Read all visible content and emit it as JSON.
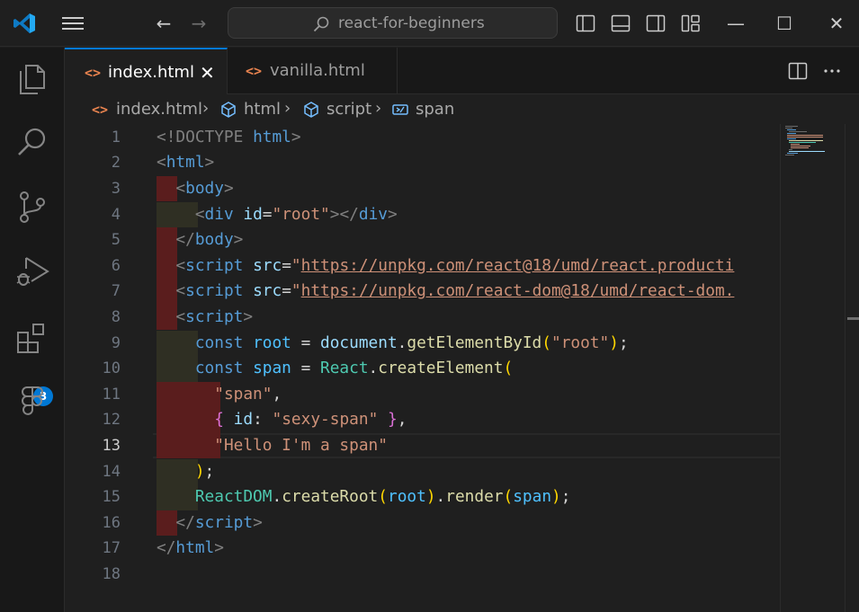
{
  "titlebar": {
    "search_text": "react-for-beginners",
    "back_label": "←",
    "forward_label": "→",
    "minimize_label": "—",
    "maximize_label": "☐",
    "close_label": "✕"
  },
  "activity_bar": {
    "items": [
      "explorer-icon",
      "search-icon",
      "source-control-icon",
      "run-debug-icon",
      "extensions-icon",
      "figma-icon"
    ],
    "extensions_badge": "3"
  },
  "tabs": [
    {
      "label": "index.html",
      "icon": "<>",
      "active": true,
      "close": "✕"
    },
    {
      "label": "vanilla.html",
      "icon": "<>",
      "active": false
    }
  ],
  "breadcrumb": {
    "file": "index.html",
    "items": [
      "html",
      "script",
      "span"
    ],
    "file_icon": "<>"
  },
  "editor": {
    "current_line": 13,
    "line_numbers": [
      "1",
      "2",
      "3",
      "4",
      "5",
      "6",
      "7",
      "8",
      "9",
      "10",
      "11",
      "12",
      "13",
      "14",
      "15",
      "16",
      "17",
      "18"
    ],
    "lines": [
      {
        "tokens": [
          [
            "t-tag",
            "<!DOCTYPE "
          ],
          [
            "t-tname",
            "html"
          ],
          [
            "t-tag",
            ">"
          ]
        ]
      },
      {
        "tokens": [
          [
            "t-tag",
            "<"
          ],
          [
            "t-tname",
            "html"
          ],
          [
            "t-tag",
            ">"
          ]
        ]
      },
      {
        "tokens": [
          [
            "t-plain",
            "  "
          ],
          [
            "t-tag",
            "<"
          ],
          [
            "t-tname",
            "body"
          ],
          [
            "t-tag",
            ">"
          ]
        ]
      },
      {
        "tokens": [
          [
            "t-plain",
            "    "
          ],
          [
            "t-tag",
            "<"
          ],
          [
            "t-tname",
            "div "
          ],
          [
            "t-attr",
            "id"
          ],
          [
            "t-plain",
            "="
          ],
          [
            "t-str",
            "\"root\""
          ],
          [
            "t-tag",
            "></"
          ],
          [
            "t-tname",
            "div"
          ],
          [
            "t-tag",
            ">"
          ]
        ]
      },
      {
        "tokens": [
          [
            "t-plain",
            "  "
          ],
          [
            "t-tag",
            "</"
          ],
          [
            "t-tname",
            "body"
          ],
          [
            "t-tag",
            ">"
          ]
        ]
      },
      {
        "tokens": [
          [
            "t-plain",
            "  "
          ],
          [
            "t-tag",
            "<"
          ],
          [
            "t-tname",
            "script "
          ],
          [
            "t-attr",
            "src"
          ],
          [
            "t-plain",
            "="
          ],
          [
            "t-str",
            "\""
          ],
          [
            "t-link",
            "https://unpkg.com/react@18/umd/react.producti"
          ]
        ]
      },
      {
        "tokens": [
          [
            "t-plain",
            "  "
          ],
          [
            "t-tag",
            "<"
          ],
          [
            "t-tname",
            "script "
          ],
          [
            "t-attr",
            "src"
          ],
          [
            "t-plain",
            "="
          ],
          [
            "t-str",
            "\""
          ],
          [
            "t-link",
            "https://unpkg.com/react-dom@18/umd/react-dom."
          ]
        ]
      },
      {
        "tokens": [
          [
            "t-plain",
            "  "
          ],
          [
            "t-tag",
            "<"
          ],
          [
            "t-tname",
            "script"
          ],
          [
            "t-tag",
            ">"
          ]
        ]
      },
      {
        "tokens": [
          [
            "t-plain",
            "    "
          ],
          [
            "t-kw",
            "const "
          ],
          [
            "t-var",
            "root"
          ],
          [
            "t-plain",
            " = "
          ],
          [
            "t-prop",
            "document"
          ],
          [
            "t-plain",
            "."
          ],
          [
            "t-fn",
            "getElementById"
          ],
          [
            "t-par1",
            "("
          ],
          [
            "t-str",
            "\"root\""
          ],
          [
            "t-par1",
            ")"
          ],
          [
            "t-plain",
            ";"
          ]
        ]
      },
      {
        "tokens": [
          [
            "t-plain",
            "    "
          ],
          [
            "t-kw",
            "const "
          ],
          [
            "t-var",
            "span"
          ],
          [
            "t-plain",
            " = "
          ],
          [
            "t-cls",
            "React"
          ],
          [
            "t-plain",
            "."
          ],
          [
            "t-fn",
            "createElement"
          ],
          [
            "t-par1",
            "("
          ]
        ]
      },
      {
        "tokens": [
          [
            "t-plain",
            "      "
          ],
          [
            "t-str",
            "\"span\""
          ],
          [
            "t-plain",
            ","
          ]
        ]
      },
      {
        "tokens": [
          [
            "t-plain",
            "      "
          ],
          [
            "t-par2",
            "{"
          ],
          [
            "t-plain",
            " "
          ],
          [
            "t-prop",
            "id"
          ],
          [
            "t-plain",
            ": "
          ],
          [
            "t-str",
            "\"sexy-span\""
          ],
          [
            "t-plain",
            " "
          ],
          [
            "t-par2",
            "}"
          ],
          [
            "t-plain",
            ","
          ]
        ]
      },
      {
        "tokens": [
          [
            "t-plain",
            "      "
          ],
          [
            "t-str",
            "\"Hello I'm a span\""
          ]
        ]
      },
      {
        "tokens": [
          [
            "t-plain",
            "    "
          ],
          [
            "t-par1",
            ")"
          ],
          [
            "t-plain",
            ";"
          ]
        ]
      },
      {
        "tokens": [
          [
            "t-plain",
            "    "
          ],
          [
            "t-cls",
            "ReactDOM"
          ],
          [
            "t-plain",
            "."
          ],
          [
            "t-fn",
            "createRoot"
          ],
          [
            "t-par1",
            "("
          ],
          [
            "t-var",
            "root"
          ],
          [
            "t-par1",
            ")"
          ],
          [
            "t-plain",
            "."
          ],
          [
            "t-fn",
            "render"
          ],
          [
            "t-par1",
            "("
          ],
          [
            "t-var",
            "span"
          ],
          [
            "t-par1",
            ")"
          ],
          [
            "t-plain",
            ";"
          ]
        ]
      },
      {
        "tokens": [
          [
            "t-plain",
            "  "
          ],
          [
            "t-tag",
            "</"
          ],
          [
            "t-tname",
            "script"
          ],
          [
            "t-tag",
            ">"
          ]
        ]
      },
      {
        "tokens": [
          [
            "t-tag",
            "</"
          ],
          [
            "t-tname",
            "html"
          ],
          [
            "t-tag",
            ">"
          ]
        ]
      },
      {
        "tokens": []
      }
    ]
  },
  "colors": {
    "indent_red": "#5a1d1d",
    "indent_olive": "#2f2f23",
    "accent": "#0078d4",
    "vscode_blue": "#23a9f2"
  }
}
